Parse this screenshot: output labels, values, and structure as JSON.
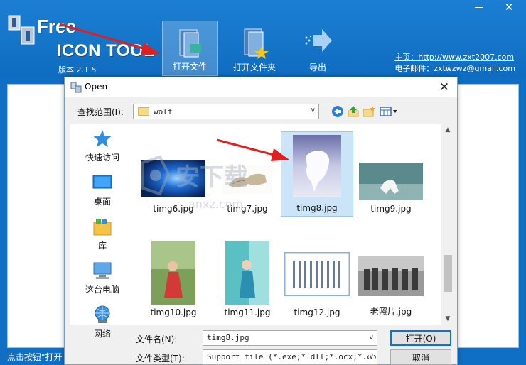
{
  "app": {
    "logo_free": "Free",
    "logo_title": "ICON TOOL",
    "version": "版本 2.1.5",
    "window_minimize": "—",
    "window_close": "✕",
    "toolbar": {
      "open_file": "打开文件",
      "open_folder": "打开文件夹",
      "export": "导出"
    },
    "homepage_line": "主页：http://www.zxt2007.com",
    "email_line": "电子邮件：zxtwzwz@gmail.com",
    "status_text": "点击按钮\"打开"
  },
  "dialog": {
    "title": "Open",
    "close": "✕",
    "look_in_label": "查找范围(I):",
    "look_in_value": "wolf",
    "places": [
      {
        "label": "快速访问",
        "icon": "star-icon"
      },
      {
        "label": "桌面",
        "icon": "desktop-icon"
      },
      {
        "label": "库",
        "icon": "library-icon"
      },
      {
        "label": "这台电脑",
        "icon": "computer-icon"
      },
      {
        "label": "网络",
        "icon": "network-icon"
      }
    ],
    "files": [
      {
        "name": "timg6.jpg",
        "selected": false
      },
      {
        "name": "timg7.jpg",
        "selected": false
      },
      {
        "name": "timg8.jpg",
        "selected": true
      },
      {
        "name": "timg9.jpg",
        "selected": false
      },
      {
        "name": "timg10.jpg",
        "selected": false
      },
      {
        "name": "timg11.jpg",
        "selected": false
      },
      {
        "name": "timg12.jpg",
        "selected": false
      },
      {
        "name": "老照片.jpg",
        "selected": false
      }
    ],
    "file_name_label": "文件名(N):",
    "file_name_value": "timg8.jpg",
    "file_type_label": "文件类型(T):",
    "file_type_value": "Support file (*.exe;*.dll;*.ocx;*.cpl",
    "open_button": "打开(O)",
    "cancel_button": "取消"
  },
  "colors": {
    "app_blue": "#0e6fc4",
    "selection": "#cce4f7",
    "arrow_red": "#e02020"
  }
}
